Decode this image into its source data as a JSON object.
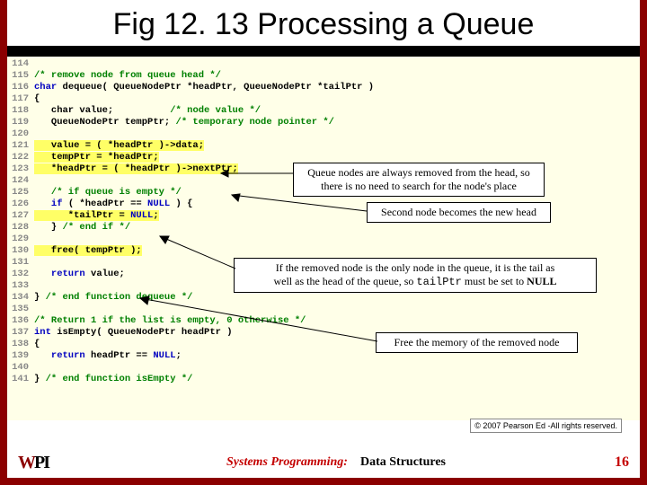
{
  "title": "Fig 12. 13 Processing a Queue",
  "code": {
    "lines": [
      {
        "n": "114",
        "t": ""
      },
      {
        "n": "115",
        "t": "/* remove node from queue head */",
        "cls": "cm"
      },
      {
        "n": "116",
        "pre": "char",
        "mid": " dequeue( QueueNodePtr *headPtr, QueueNodePtr *tailPtr )",
        "cls": "kw"
      },
      {
        "n": "117",
        "t": "{",
        "cls": "dk"
      },
      {
        "n": "118",
        "pre": "   char",
        "mid": " value;          ",
        "post": "/* node value */"
      },
      {
        "n": "119",
        "pre": "   QueueNodePtr tempPtr; ",
        "post": "/* temporary node pointer */"
      },
      {
        "n": "120",
        "t": ""
      },
      {
        "n": "121",
        "hl": "   value = ( *headPtr )->data;"
      },
      {
        "n": "122",
        "hl": "   tempPtr = *headPtr;"
      },
      {
        "n": "123",
        "hl": "   *headPtr = ( *headPtr )->nextPtr;"
      },
      {
        "n": "124",
        "t": ""
      },
      {
        "n": "125",
        "post": "   /* if queue is empty */"
      },
      {
        "n": "126",
        "pre": "   if",
        "mid": " ( *headPtr == ",
        "null": "NULL",
        "end": " ) {",
        "cls": "kw"
      },
      {
        "n": "127",
        "hl2": "      *tailPtr = NULL;"
      },
      {
        "n": "128",
        "pre": "   } ",
        "post": "/* end if */"
      },
      {
        "n": "129",
        "t": ""
      },
      {
        "n": "130",
        "hl": "   free( tempPtr );"
      },
      {
        "n": "131",
        "t": ""
      },
      {
        "n": "132",
        "pre": "   return",
        "mid": " value;",
        "cls": "kw"
      },
      {
        "n": "133",
        "t": ""
      },
      {
        "n": "134",
        "pre": "} ",
        "post": "/* end function dequeue */"
      },
      {
        "n": "135",
        "t": ""
      },
      {
        "n": "136",
        "post": "/* Return 1 if the list is empty, 0 otherwise */"
      },
      {
        "n": "137",
        "pre": "int",
        "mid": " isEmpty( QueueNodePtr headPtr )",
        "cls": "kw"
      },
      {
        "n": "138",
        "t": "{",
        "cls": "dk"
      },
      {
        "n": "139",
        "pre": "   return",
        "mid": " headPtr == ",
        "null": "NULL",
        "end": ";",
        "cls": "kw"
      },
      {
        "n": "140",
        "t": ""
      },
      {
        "n": "141",
        "pre": "} ",
        "post": "/* end function isEmpty */"
      }
    ]
  },
  "callouts": {
    "c1": "Queue nodes are always removed from the head, so there is no need to search for the node's place",
    "c2": "Second node becomes the new head",
    "c3_a": "If the removed node is the only node in the queue, it is the tail as",
    "c3_b": "well as the head of the queue, so ",
    "c3_c": "tailPtr",
    "c3_d": " must be set to ",
    "c3_e": "NULL",
    "c4": "Free the memory of the removed node"
  },
  "copyright": "© 2007 Pearson Ed -All rights reserved.",
  "footer": {
    "left": "Systems Programming:",
    "right": "Data Structures",
    "page": "16"
  }
}
